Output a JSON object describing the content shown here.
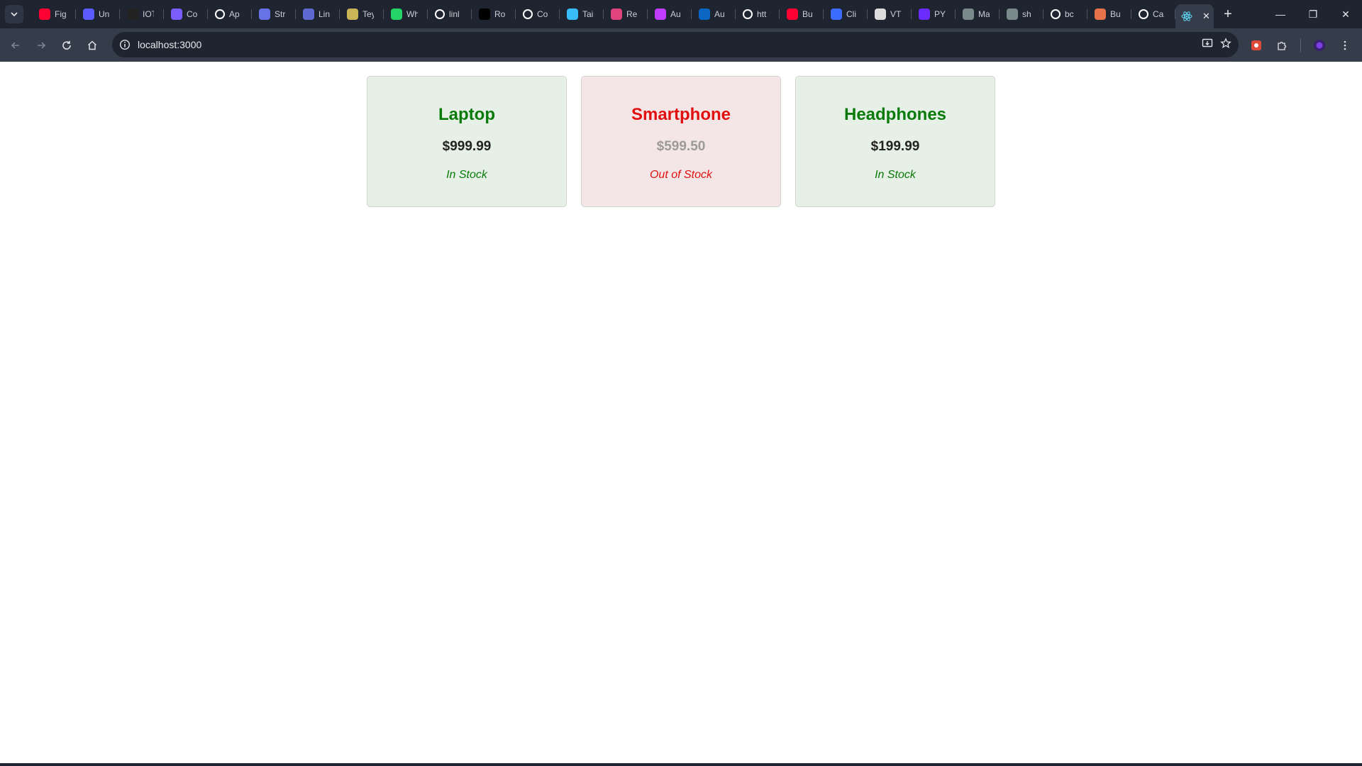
{
  "browser": {
    "tabs": [
      {
        "label": "Fig",
        "icon": "youtube-icon",
        "color": "#ff0033"
      },
      {
        "label": "Un",
        "icon": "chart-icon",
        "color": "#5b5bff"
      },
      {
        "label": "IOT",
        "icon": "circuit-icon",
        "color": "#222222"
      },
      {
        "label": "Co",
        "icon": "w-logo-icon",
        "color": "#7b5cff"
      },
      {
        "label": "Ap",
        "icon": "circle-logo-icon",
        "color": "#ffffff"
      },
      {
        "label": "Str",
        "icon": "s-logo-icon",
        "color": "#6772e5"
      },
      {
        "label": "Lin",
        "icon": "linear-icon",
        "color": "#5e6ad2"
      },
      {
        "label": "Tey",
        "icon": "globe-icon",
        "color": "#c9b458"
      },
      {
        "label": "Wh",
        "icon": "whatsapp-icon",
        "color": "#25d366"
      },
      {
        "label": "linl",
        "icon": "github-icon",
        "color": "#ffffff"
      },
      {
        "label": "Ro",
        "icon": "n-logo-icon",
        "color": "#000000"
      },
      {
        "label": "Co",
        "icon": "github-icon",
        "color": "#ffffff"
      },
      {
        "label": "Tai",
        "icon": "tailwind-icon",
        "color": "#38bdf8"
      },
      {
        "label": "Re",
        "icon": "react-icon",
        "color": "#e0447c"
      },
      {
        "label": "Au",
        "icon": "shield-icon",
        "color": "#c13cff"
      },
      {
        "label": "Au",
        "icon": "linkedin-icon",
        "color": "#0a66c2"
      },
      {
        "label": "htt",
        "icon": "google-icon",
        "color": "#ffffff"
      },
      {
        "label": "Bu",
        "icon": "youtube-icon",
        "color": "#ff0033"
      },
      {
        "label": "Cli",
        "icon": "shield-icon",
        "color": "#3b6bff"
      },
      {
        "label": "VT",
        "icon": "document-icon",
        "color": "#dddddd"
      },
      {
        "label": "PY",
        "icon": "dot-icon",
        "color": "#6a2cff"
      },
      {
        "label": "Ma",
        "icon": "doc-lines-icon",
        "color": "#7a8a8a"
      },
      {
        "label": "sh",
        "icon": "doc-lines-icon",
        "color": "#7a8a8a"
      },
      {
        "label": "bc",
        "icon": "github-icon",
        "color": "#ffffff"
      },
      {
        "label": "Bu",
        "icon": "asterisk-icon",
        "color": "#e8734a"
      },
      {
        "label": "Ca",
        "icon": "openai-icon",
        "color": "#ffffff"
      }
    ],
    "active_tab": {
      "icon": "react-icon",
      "color": "#61dafb"
    },
    "url": "localhost:3000"
  },
  "products": [
    {
      "name": "Laptop",
      "price": "$999.99",
      "status": "In Stock",
      "in_stock": true
    },
    {
      "name": "Smartphone",
      "price": "$599.50",
      "status": "Out of Stock",
      "in_stock": false
    },
    {
      "name": "Headphones",
      "price": "$199.99",
      "status": "In Stock",
      "in_stock": true
    }
  ],
  "colors": {
    "in_stock": "#0a7a0a",
    "out_of_stock": "#e01010",
    "in_stock_bg": "#e6f0e6",
    "out_of_stock_bg": "#f4e6e6"
  }
}
